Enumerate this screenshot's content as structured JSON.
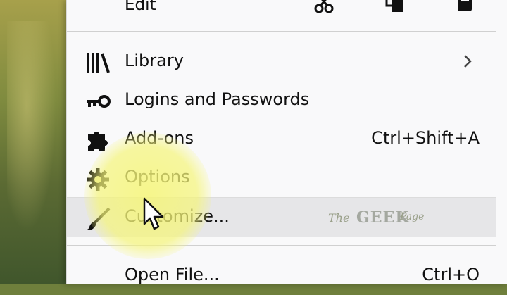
{
  "edit_row": {
    "label": "Edit",
    "icons": [
      "scissors-icon",
      "copy-icon",
      "paste-icon"
    ]
  },
  "menu": {
    "items": [
      {
        "label": "Library",
        "icon": "library-icon",
        "shortcut": "",
        "has_submenu": true
      },
      {
        "label": "Logins and Passwords",
        "icon": "key-icon",
        "shortcut": ""
      },
      {
        "label": "Add-ons",
        "icon": "puzzle-icon",
        "shortcut": "Ctrl+Shift+A"
      },
      {
        "label": "Options",
        "icon": "gear-icon",
        "shortcut": ""
      },
      {
        "label": "Customize...",
        "icon": "paintbrush-icon",
        "shortcut": "",
        "hovered": true
      },
      {
        "label": "Open File...",
        "icon": "",
        "shortcut": "Ctrl+O"
      }
    ]
  },
  "watermark": {
    "the": "The",
    "geek": "GEEK",
    "page": "Page"
  },
  "colors": {
    "menu_bg": "#f9f9fa",
    "hover_bg": "#e6e6e8",
    "highlight": "#f5f578"
  }
}
